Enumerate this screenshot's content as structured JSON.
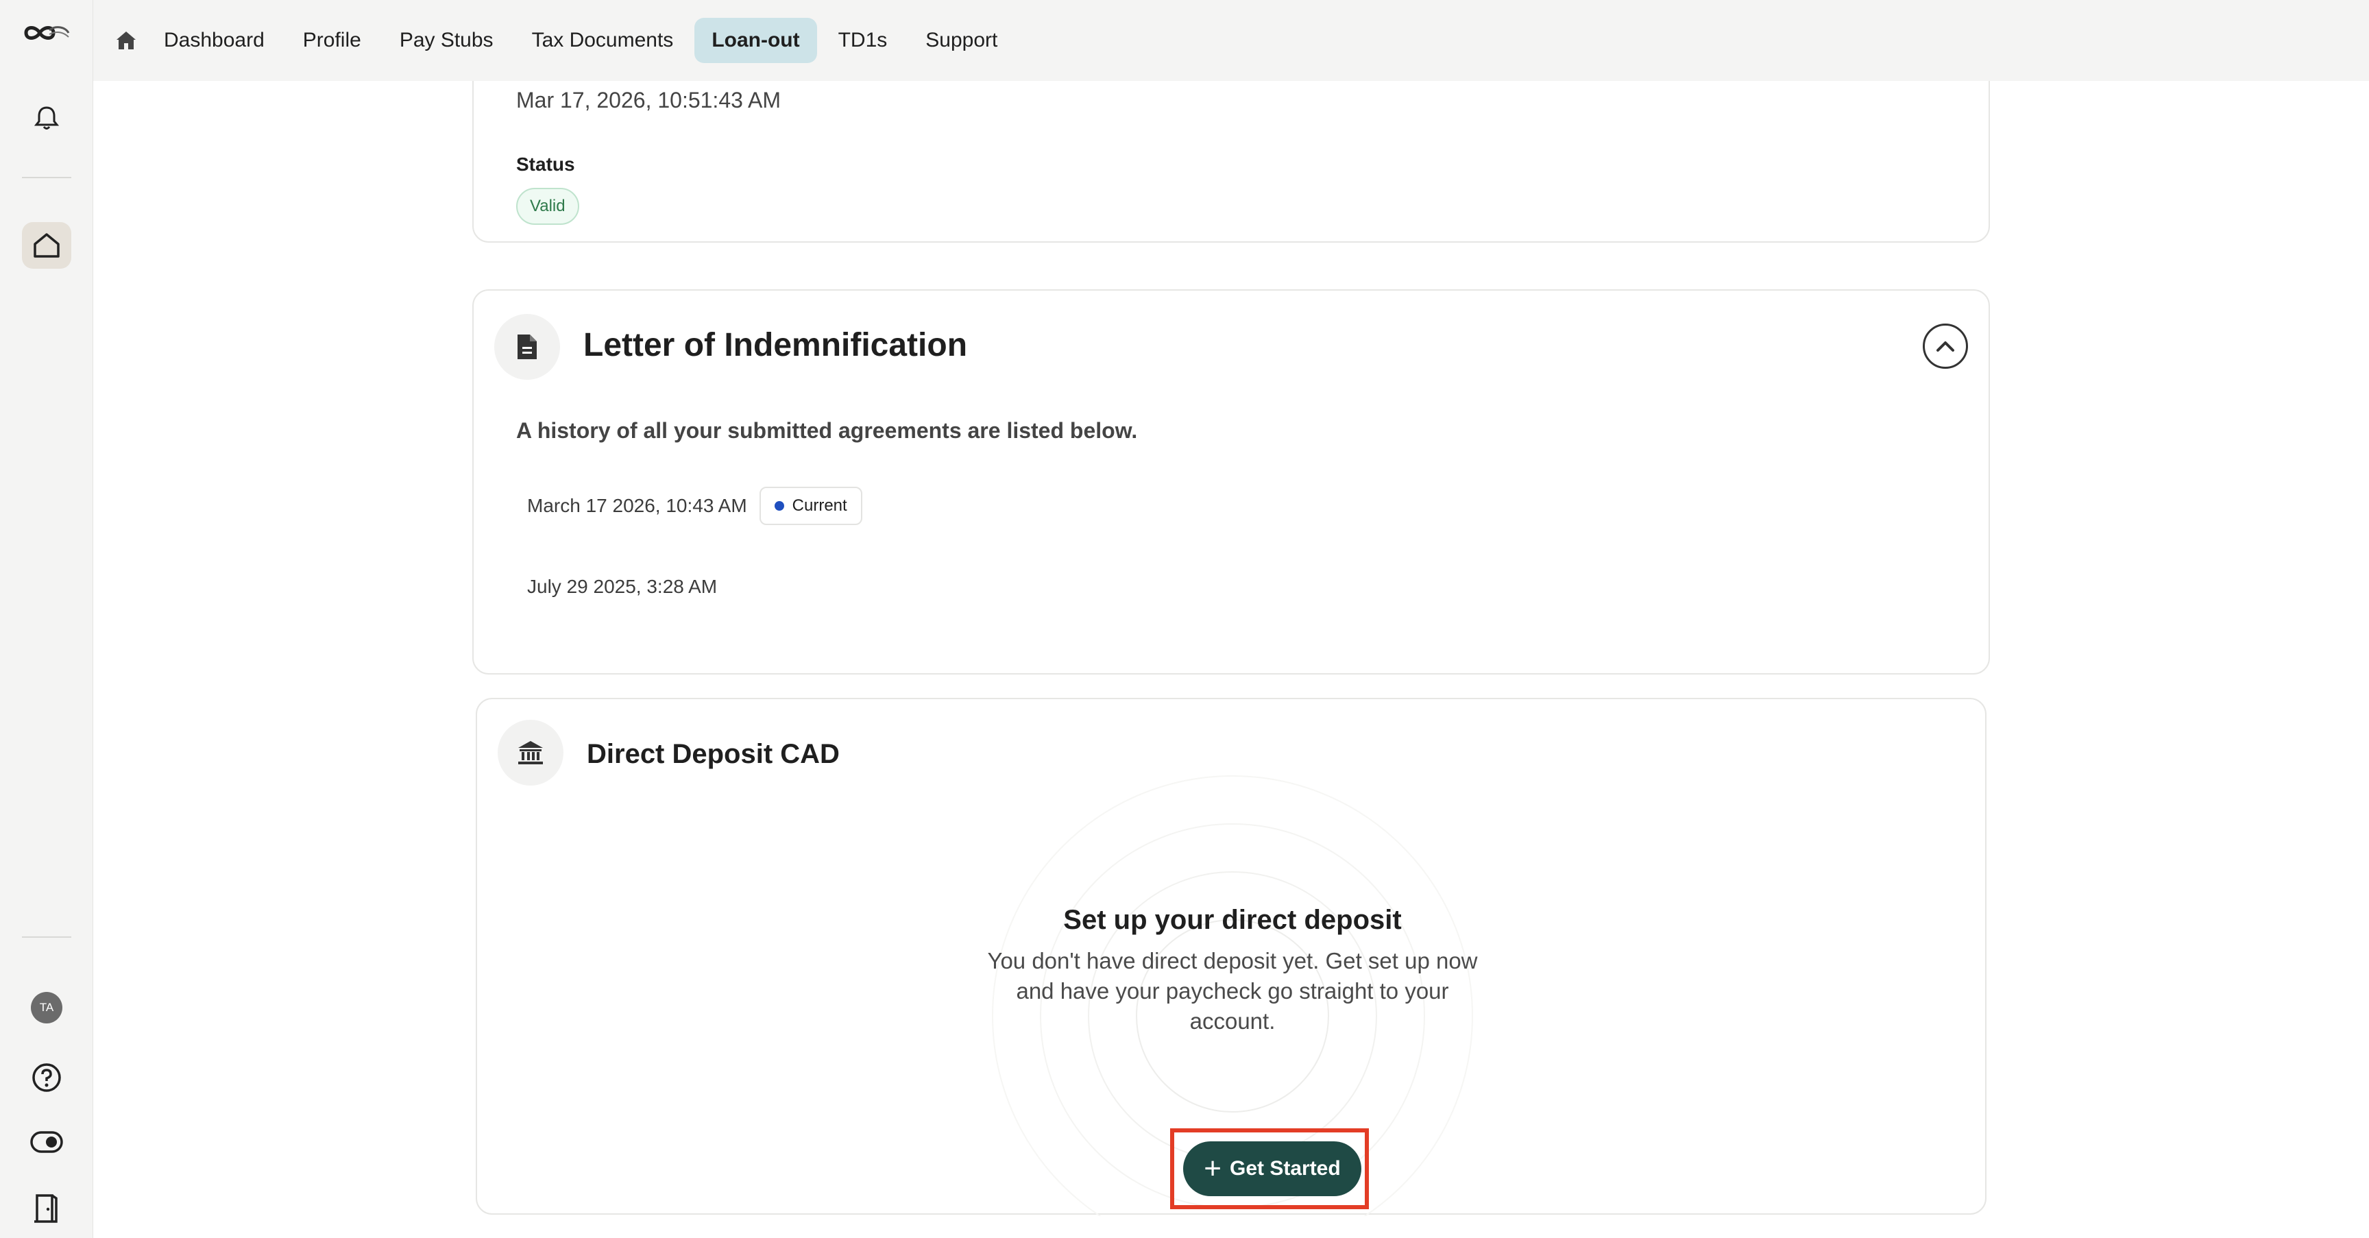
{
  "nav": {
    "items": [
      {
        "label": "Dashboard"
      },
      {
        "label": "Profile"
      },
      {
        "label": "Pay Stubs"
      },
      {
        "label": "Tax Documents"
      },
      {
        "label": "Loan-out",
        "active": true
      },
      {
        "label": "TD1s"
      },
      {
        "label": "Support"
      }
    ]
  },
  "rail": {
    "avatar_initials": "TA"
  },
  "top_card": {
    "datetime": "Mar 17, 2026, 10:51:43 AM",
    "status_label": "Status",
    "status_value": "Valid"
  },
  "loi": {
    "title": "Letter of Indemnification",
    "description": "A history of all your submitted agreements are listed below.",
    "history": [
      {
        "date": "March 17 2026, 10:43 AM",
        "badge": "Current"
      },
      {
        "date": "July 29 2025, 3:28 AM"
      }
    ]
  },
  "direct_deposit": {
    "title": "Direct Deposit CAD",
    "setup_title": "Set up your direct deposit",
    "setup_text": "You don't have direct deposit yet. Get set up now and have your paycheck go straight to your account.",
    "cta_label": "Get Started"
  },
  "colors": {
    "accent_active_tab": "#cde3e8",
    "cta": "#1f4a45",
    "highlight": "#e33d26",
    "valid": "#2f7a4b",
    "current_dot": "#1f4fbf"
  }
}
